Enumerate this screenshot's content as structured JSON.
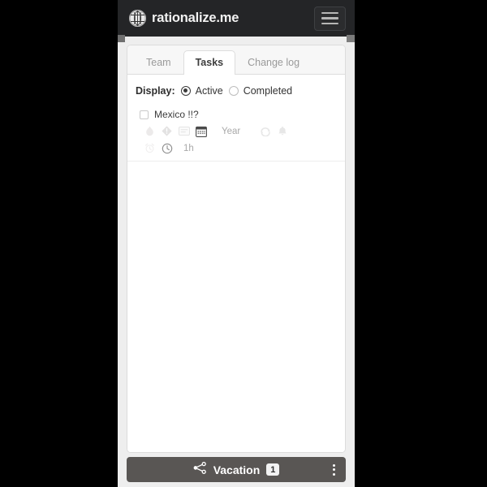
{
  "header": {
    "brand_name": "rationalize.me",
    "logo_icon": "brain-globe-icon",
    "menu_icon": "hamburger-menu-icon"
  },
  "tabs": [
    {
      "label": "Team",
      "active": false
    },
    {
      "label": "Tasks",
      "active": true
    },
    {
      "label": "Change log",
      "active": false
    }
  ],
  "display": {
    "label": "Display:",
    "options": [
      {
        "label": "Active",
        "selected": true
      },
      {
        "label": "Completed",
        "selected": false
      }
    ]
  },
  "task": {
    "title": "Mexico !!?",
    "checked": false,
    "meta": {
      "urgency_icon": "flame-icon",
      "priority_icon": "diamond-exclamation-icon",
      "note_icon": "note-lines-icon",
      "calendar_icon": "calendar-icon",
      "date_value": "Year",
      "repeat_icon": "repeat-loop-icon",
      "reminder_icon": "bell-icon",
      "alarm_icon": "alarm-clock-icon",
      "duration_icon": "clock-icon",
      "duration_value": "1h"
    }
  },
  "bottom_bar": {
    "share_icon": "share-nodes-icon",
    "label": "Vacation",
    "badge": "1",
    "more_icon": "kebab-menu-icon"
  },
  "colors": {
    "header_bg": "#242527",
    "page_bg": "#eeeeee",
    "card_bg": "#ffffff",
    "bottom_bar_bg": "#595654",
    "muted_text": "#a9a9a9"
  }
}
